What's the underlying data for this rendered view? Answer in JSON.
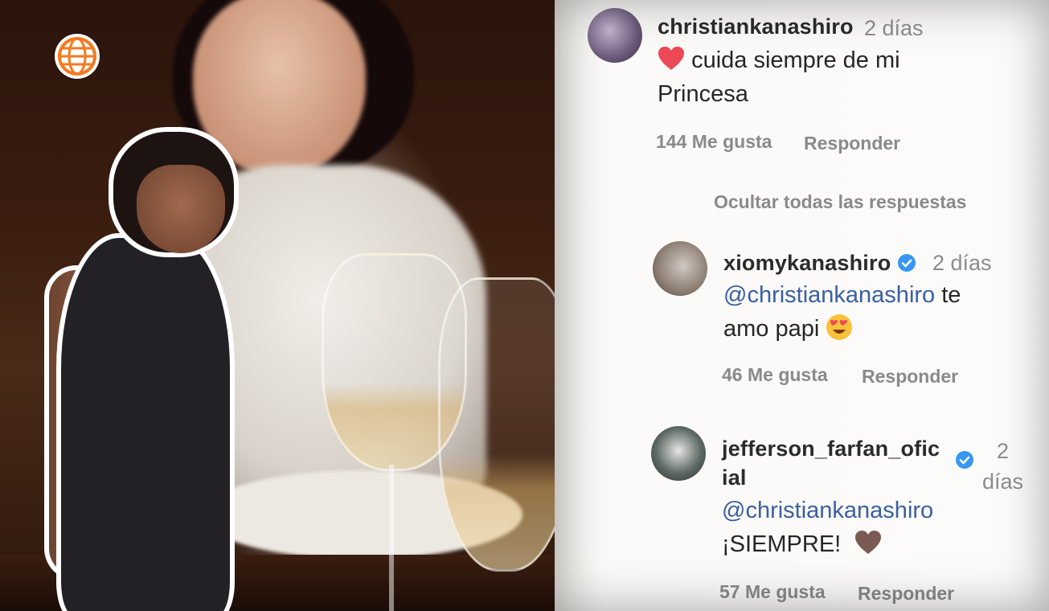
{
  "colors": {
    "panel_bg": "#fbfbfa",
    "username": "#2b2b2b",
    "muted": "#8a8a8a",
    "mention": "#3a5fa0",
    "verified": "#3897f0",
    "heart": "#ed4956",
    "logo_orange": "#f47a20"
  },
  "comments": [
    {
      "username": "christiankanashiro",
      "time": "2 días",
      "text_line1": "cuida siempre de mi",
      "text_line2": "Princesa",
      "emoji": "red-heart",
      "likes": "144 Me gusta",
      "reply_label": "Responder"
    }
  ],
  "hide_replies_label": "Ocultar todas las respuestas",
  "replies": [
    {
      "username": "xiomykanashiro",
      "verified": true,
      "time": "2 días",
      "mention": "@christiankanashiro",
      "text_after_mention": "te",
      "text_line2": "amo papi",
      "emoji": "heart-eyes",
      "likes": "46 Me gusta",
      "reply_label": "Responder"
    },
    {
      "username_line1": "jefferson_farfan_ofic",
      "username_line2": "ial",
      "verified": true,
      "time_line1": "2",
      "time_line2": "días",
      "mention": "@christiankanashiro",
      "text": "¡SIEMPRE!",
      "emoji": "brown-heart",
      "likes": "57 Me gusta",
      "reply_label": "Responder"
    }
  ]
}
